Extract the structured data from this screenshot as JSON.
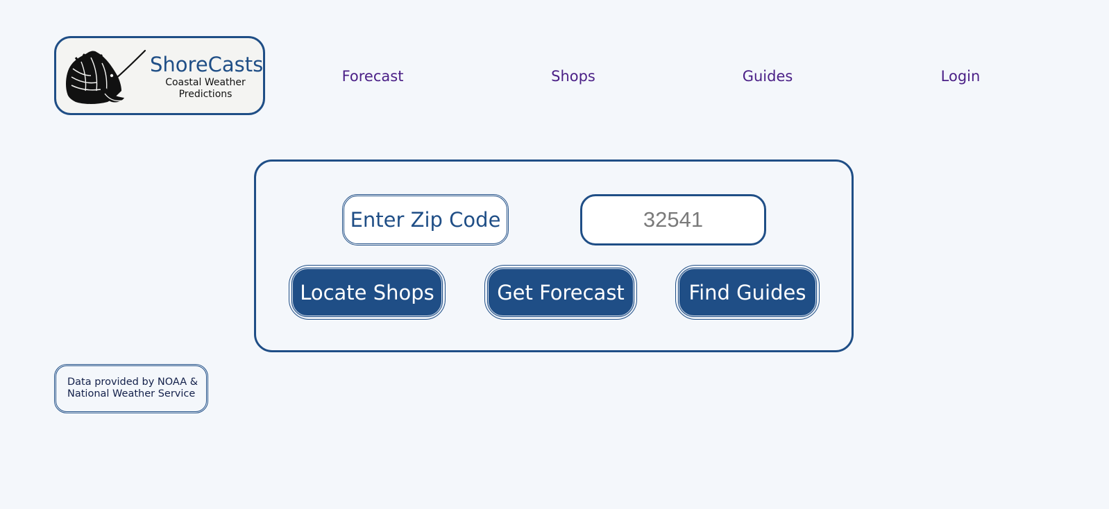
{
  "brand": {
    "name": "ShoreCasts",
    "tagline": "Coastal Weather Predictions",
    "logo_icon": "sailfish-icon"
  },
  "nav": {
    "items": [
      {
        "label": "Forecast"
      },
      {
        "label": "Shops"
      },
      {
        "label": "Guides"
      },
      {
        "label": "Login"
      }
    ]
  },
  "search": {
    "zip_label": "Enter Zip Code",
    "zip_placeholder": "32541",
    "zip_value": ""
  },
  "actions": {
    "locate_shops": "Locate Shops",
    "get_forecast": "Get Forecast",
    "find_guides": "Find Guides"
  },
  "footer": {
    "credit": "Data provided by NOAA & National Weather Service"
  },
  "colors": {
    "background": "#f4f7fb",
    "primary": "#1f4e86",
    "nav_link": "#4a1f86",
    "logo_background": "#f4f4f2"
  }
}
